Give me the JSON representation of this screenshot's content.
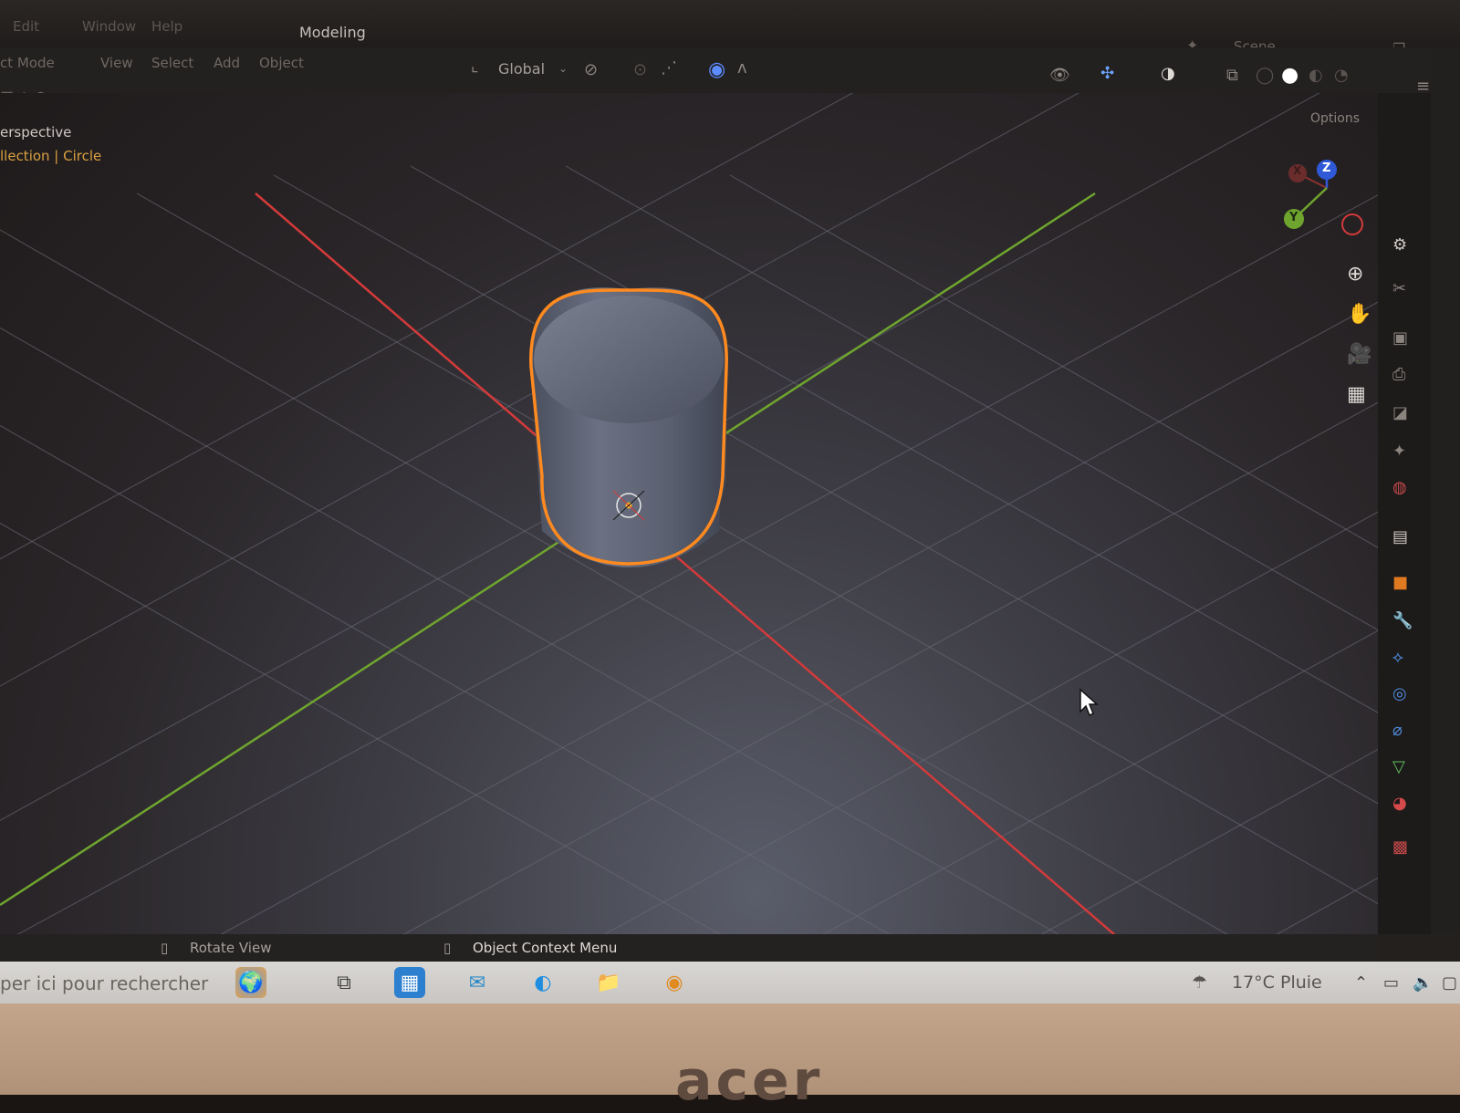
{
  "topbar": {
    "menu": [
      "Edit",
      "Window",
      "Help"
    ],
    "workspace_tab": "Modeling",
    "scene": "Scene"
  },
  "header": {
    "mode": "ct Mode",
    "menus": [
      "View",
      "Select",
      "Add",
      "Object"
    ],
    "transform_orientation": "Global"
  },
  "viewport": {
    "view_label": "erspective",
    "collection_label": "llection | Circle",
    "options_label": "Options"
  },
  "gizmo": {
    "x": "X",
    "y": "Y",
    "z": "Z"
  },
  "statusbar": {
    "rotate_view": "Rotate View",
    "context_menu": "Object Context Menu"
  },
  "taskbar": {
    "search_placeholder": "per ici pour rechercher",
    "weather": "17°C  Pluie"
  },
  "laptop": {
    "brand": "acer"
  },
  "colors": {
    "selection_outline": "#ff8a1f",
    "x_axis": "#d43a3a",
    "y_axis": "#6fa52e",
    "z_axis": "#2f59d6"
  }
}
